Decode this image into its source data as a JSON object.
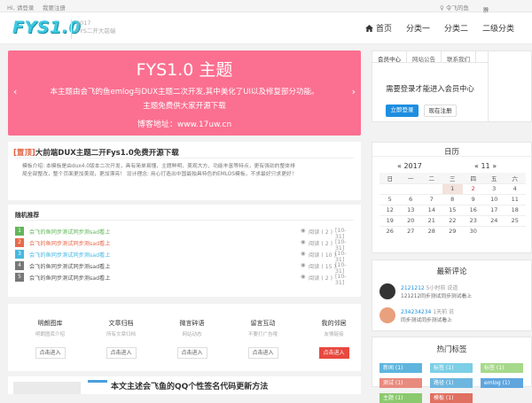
{
  "topbar": {
    "hi": "Hi, 请登录",
    "register": "我要注册",
    "right1": "♀ 令飞的鱼",
    "right2": "联系本站"
  },
  "header": {
    "logo": "FYS1.0",
    "slogan1": "2017",
    "slogan2": "FYS二开大前端"
  },
  "nav": {
    "items": [
      "首页",
      "分类一",
      "分类二",
      "二级分类"
    ]
  },
  "banner": {
    "title": "FYS1.0 主题",
    "line1": "本主题由会飞的鱼emlog与DUX主题二次开发,其中美化了UI以及修复部分功能。",
    "line2": "主题免费供大家开源下载",
    "line3": "博客地址：www.17uw.cn",
    "prev": "‹",
    "next": "›"
  },
  "top_post": {
    "tag": "[置顶]",
    "title": "大前端DUX主题二开Fys1.0免费开源下载",
    "body1": "模板介绍: 本模板是由dux4.0版本二次开发，具有简单易懂、主题鲜明、美观大方、功能丰富等特点，更有强劲的整体排",
    "body2": "局全部整改，整个页面更加美观，更加漂亮！ 设计理念: 用心打造出中国最独具特色的EMLOS模板，不求最好只求更好！"
  },
  "random": {
    "title": "随机推荐",
    "colors": [
      "#63b55a",
      "#e66a4c",
      "#49b8e0",
      "#777",
      "#777"
    ],
    "items": [
      {
        "num": "1",
        "title": "会飞的鱼同步测试同步测sad看上",
        "views": "阅读 ( 2 )",
        "date": "[10-31]"
      },
      {
        "num": "2",
        "title": "会飞的鱼同步测试同步测sad看上",
        "views": "阅读 ( 2 )",
        "date": "[10-31]"
      },
      {
        "num": "3",
        "title": "会飞的鱼同步测试同步测sad看上",
        "views": "阅读 ( 10 )",
        "date": "[10-31]"
      },
      {
        "num": "4",
        "title": "会飞的鱼同步测试同步测sad看上",
        "views": "阅读 ( 15 )",
        "date": "[10-31]"
      },
      {
        "num": "5",
        "title": "会飞的鱼同步测试同步测sad看上",
        "views": "阅读 ( 2 )",
        "date": "[10-31]"
      }
    ]
  },
  "features": [
    {
      "title": "明朗图库",
      "sub": "明朗图库介绍",
      "btn": "点击进入"
    },
    {
      "title": "文章归档",
      "sub": "所有文章归档",
      "btn": "点击进入"
    },
    {
      "title": "微言碎语",
      "sub": "网站动态",
      "btn": "点击进入"
    },
    {
      "title": "留言互动",
      "sub": "不要打广告哦",
      "btn": "点击进入"
    },
    {
      "title": "我的邻居",
      "sub": "友情链接",
      "btn": "点击进入"
    }
  ],
  "bottom_partial": "本文主述会飞鱼的QQ个性签名代码更新方法",
  "member": {
    "tabs": [
      "会员中心",
      "网站公告",
      "联系我们"
    ],
    "msg": "需要登录才能进入会员中心",
    "login": "立即登录",
    "reg": "现在注册"
  },
  "calendar": {
    "title": "日历",
    "year": "2017",
    "month": "11",
    "prev": "«",
    "next": "»",
    "headers": [
      "日",
      "一",
      "二",
      "三",
      "四",
      "五",
      "六"
    ],
    "rows": [
      [
        "",
        "",
        "",
        "1",
        "2",
        "3",
        "4"
      ],
      [
        "5",
        "6",
        "7",
        "8",
        "9",
        "10",
        "11"
      ],
      [
        "12",
        "13",
        "14",
        "15",
        "16",
        "17",
        "18"
      ],
      [
        "19",
        "20",
        "21",
        "22",
        "23",
        "24",
        "25"
      ],
      [
        "26",
        "27",
        "28",
        "29",
        "30",
        "",
        ""
      ]
    ]
  },
  "comments": {
    "title": "最新评论",
    "items": [
      {
        "name": "2121212",
        "time": "5小时前",
        "action": "说道",
        "text": "121212同步测试同步测试看上"
      },
      {
        "name": "234234234",
        "time": "1天前",
        "action": "说",
        "text": "同步测试同步测试看上"
      }
    ]
  },
  "tags": {
    "title": "热门标签",
    "items": [
      {
        "label": "新闻 (1)",
        "color": "#5db5de"
      },
      {
        "label": "标签 (1)",
        "color": "#7ccfe6"
      },
      {
        "label": "标签 (1)",
        "color": "#a7d98c"
      },
      {
        "label": "测试 (1)",
        "color": "#e88a7d"
      },
      {
        "label": "路径 (1)",
        "color": "#6db6e0"
      },
      {
        "label": "emlog (1)",
        "color": "#5fa5de"
      },
      {
        "label": "主题 (1)",
        "color": "#8bc96f"
      },
      {
        "label": "模板 (1)",
        "color": "#e07060"
      }
    ]
  }
}
